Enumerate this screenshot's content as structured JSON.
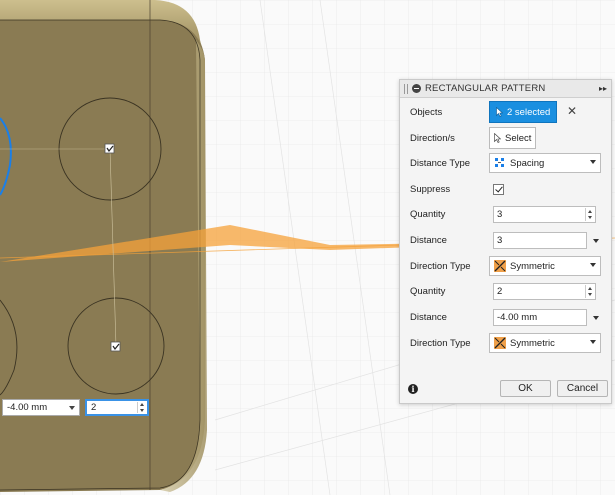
{
  "panel": {
    "title": "RECTANGULAR PATTERN",
    "objects": {
      "label": "Objects",
      "value": "2 selected"
    },
    "directions": {
      "label": "Direction/s",
      "button": "Select"
    },
    "distance_type": {
      "label": "Distance Type",
      "value": "Spacing"
    },
    "suppress": {
      "label": "Suppress",
      "checked": true
    },
    "quantity1": {
      "label": "Quantity",
      "value": "3"
    },
    "distance1": {
      "label": "Distance",
      "value": "3"
    },
    "direction_type1": {
      "label": "Direction Type",
      "value": "Symmetric"
    },
    "quantity2": {
      "label": "Quantity",
      "value": "2"
    },
    "distance2": {
      "label": "Distance",
      "value": "-4.00 mm"
    },
    "direction_type2": {
      "label": "Direction Type",
      "value": "Symmetric"
    },
    "ok_label": "OK",
    "cancel_label": "Cancel",
    "info_glyph": "i"
  },
  "onscreen_inputs": {
    "distance": "-4.00 mm",
    "quantity": "2"
  },
  "viewport": {
    "checkbox_markers": 2
  },
  "colors": {
    "accent": "#1a8fe0",
    "body_fill": "#8a7b53",
    "orange_axis": "#f5a23a",
    "selection_blue": "#1a7fe8"
  }
}
